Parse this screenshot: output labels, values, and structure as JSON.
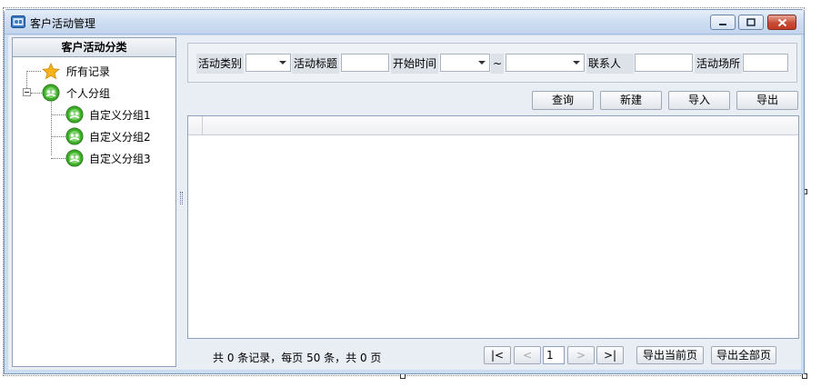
{
  "window": {
    "title": "客户活动管理",
    "buttons": {
      "minimize": "minimize",
      "maximize": "maximize",
      "close": "close"
    }
  },
  "tree": {
    "header": "客户活动分类",
    "nodes": [
      {
        "label": "所有记录",
        "icon": "star-icon"
      },
      {
        "label": "个人分组",
        "icon": "group-icon",
        "expanded": true
      },
      {
        "label": "自定义分组1",
        "icon": "group-icon"
      },
      {
        "label": "自定义分组2",
        "icon": "group-icon"
      },
      {
        "label": "自定义分组3",
        "icon": "group-icon"
      }
    ]
  },
  "filters": {
    "activity_type_label": "活动类别",
    "activity_type_value": "",
    "activity_title_label": "活动标题",
    "activity_title_value": "",
    "start_time_label": "开始时间",
    "start_time_from": "",
    "range_separator": "~",
    "start_time_to": "",
    "contact_label": "联系人",
    "contact_value": "",
    "venue_label": "活动场所",
    "venue_value": ""
  },
  "toolbar": {
    "query": "查询",
    "create": "新建",
    "import": "导入",
    "export": "导出"
  },
  "pager": {
    "summary": "共 0 条记录，每页 50 条，共 0 页",
    "first": "|<",
    "prev": "<",
    "page": "1",
    "next": ">",
    "last": ">|",
    "export_current": "导出当前页",
    "export_all": "导出全部页"
  },
  "colors": {
    "titlebar": "#cddcf0",
    "close_button": "#c84c36",
    "panel_border": "#8ea2bc",
    "group_icon": "#3fae2a",
    "star_icon": "#f6b21a"
  }
}
